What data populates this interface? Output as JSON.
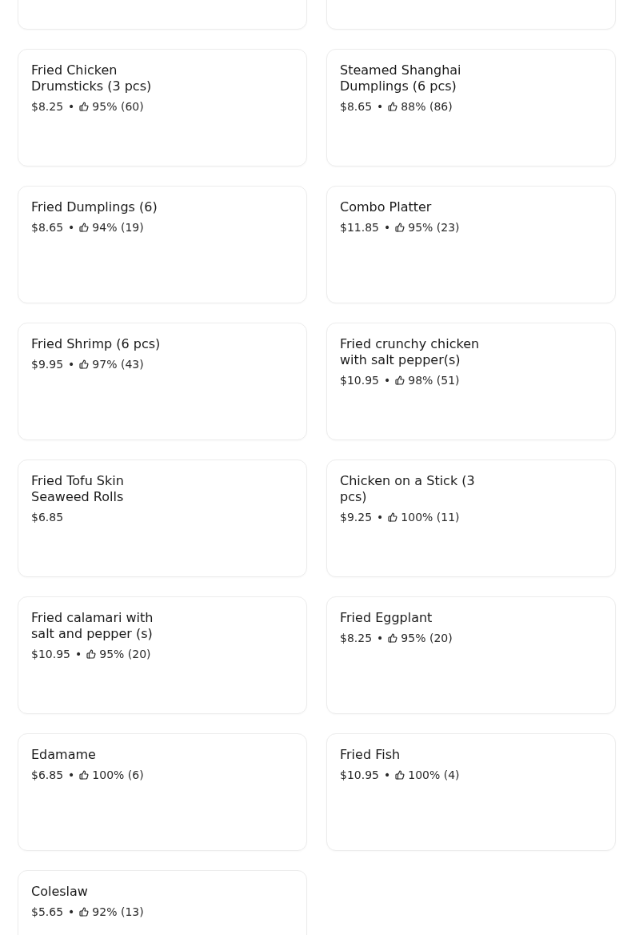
{
  "menu_items": [
    {
      "kind": "cut_off"
    },
    {
      "kind": "cut_off"
    },
    {
      "kind": "dish",
      "title": "Fried Chicken Drumsticks (3 pcs)",
      "price": "$8.25",
      "separator": "•",
      "rating": "95% (60)"
    },
    {
      "kind": "dish",
      "title": "Steamed Shanghai Dumplings (6 pcs)",
      "price": "$8.65",
      "separator": "•",
      "rating": "88% (86)"
    },
    {
      "kind": "dish",
      "title": "Fried Dumplings (6)",
      "price": "$8.65",
      "separator": "•",
      "rating": "94% (19)"
    },
    {
      "kind": "dish",
      "title": "Combo Platter",
      "price": "$11.85",
      "separator": "•",
      "rating": "95% (23)"
    },
    {
      "kind": "dish",
      "title": "Fried Shrimp (6 pcs)",
      "price": "$9.95",
      "separator": "•",
      "rating": "97% (43)"
    },
    {
      "kind": "dish",
      "title": "Fried crunchy chicken with salt pepper(s)",
      "price": "$10.95",
      "separator": "•",
      "rating": "98% (51)"
    },
    {
      "kind": "dish",
      "title": "Fried Tofu Skin Seaweed Rolls",
      "price": "$6.85"
    },
    {
      "kind": "dish",
      "title": "Chicken on a Stick (3 pcs)",
      "price": "$9.25",
      "separator": "•",
      "rating": "100% (11)"
    },
    {
      "kind": "dish",
      "title": "Fried calamari with salt and pepper (s)",
      "price": "$10.95",
      "separator": "•",
      "rating": "95% (20)"
    },
    {
      "kind": "dish",
      "title": "Fried Eggplant",
      "price": "$8.25",
      "separator": "•",
      "rating": "95% (20)"
    },
    {
      "kind": "dish",
      "title": "Edamame",
      "price": "$6.85",
      "separator": "•",
      "rating": "100% (6)"
    },
    {
      "kind": "dish",
      "title": "Fried Fish",
      "price": "$10.95",
      "separator": "•",
      "rating": "100% (4)"
    },
    {
      "kind": "dish",
      "title": "Coleslaw",
      "price": "$5.65",
      "separator": "•",
      "rating": "92% (13)"
    }
  ]
}
